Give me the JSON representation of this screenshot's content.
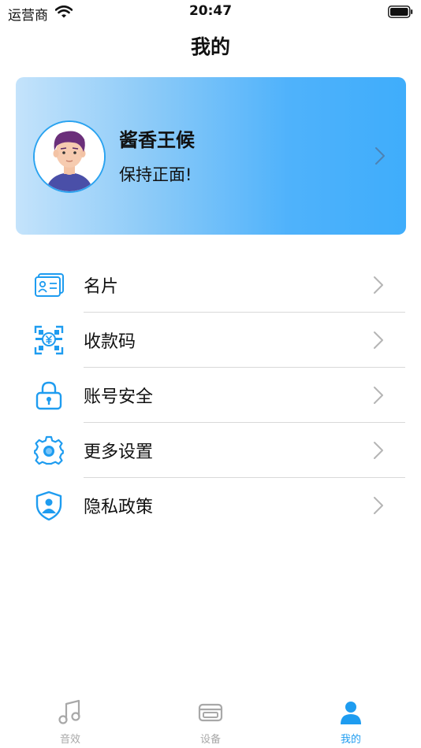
{
  "status_bar": {
    "carrier": "运营商",
    "time": "20:47"
  },
  "page_title": "我的",
  "profile": {
    "name": "酱香王候",
    "motto": "保持正面!"
  },
  "menu": [
    {
      "label": "名片",
      "icon": "business-card-icon"
    },
    {
      "label": "收款码",
      "icon": "payment-qr-icon"
    },
    {
      "label": "账号安全",
      "icon": "lock-icon"
    },
    {
      "label": "更多设置",
      "icon": "gear-icon"
    },
    {
      "label": "隐私政策",
      "icon": "shield-user-icon"
    }
  ],
  "tabs": [
    {
      "label": "音效",
      "icon": "music-note-icon",
      "active": false
    },
    {
      "label": "设备",
      "icon": "device-icon",
      "active": false
    },
    {
      "label": "我的",
      "icon": "person-icon",
      "active": true
    }
  ],
  "colors": {
    "accent": "#1e9cf0",
    "inactive_tab": "#a8a8a8",
    "divider": "#d9d9d9"
  }
}
